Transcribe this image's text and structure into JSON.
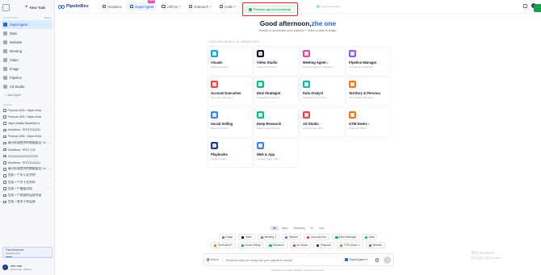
{
  "sidebar": {
    "new_task": "New Task",
    "agents_header": "AI AGENTS",
    "agents_more": "More",
    "items": [
      {
        "label": "SuperAgent",
        "icon": "superagent-icon",
        "active": true
      },
      {
        "label": "Data",
        "icon": "data-icon"
      },
      {
        "label": "Website",
        "icon": "website-icon"
      },
      {
        "label": "Meeting",
        "icon": "meeting-icon"
      },
      {
        "label": "Video",
        "icon": "video-icon"
      },
      {
        "label": "Image",
        "icon": "image-icon"
      },
      {
        "label": "Pipeline",
        "icon": "pipeline-icon"
      },
      {
        "label": "Ad Studio",
        "icon": "ad-studio-icon"
      }
    ],
    "add_agent": "Add Agent",
    "tasks_header": "TASKS",
    "tasks": [
      "Product URL: https://cha",
      "Product URL: https://cha",
      "https://static.flashintel.a",
      "Workflow: TEST2111111",
      "Product URL: https://cha",
      "请分析我提供的数据报告 :ht",
      "Workflow: TEST 101",
      "2111111111122222222",
      "Workflow: TEST2111111",
      "请分析我提供的数据报告 :ht",
      "生成一个关于北京的",
      "生成一个关于北京的",
      "生成一个播报总结",
      "生成一个或我的运营内容",
      "生成一张关于的运营"
    ],
    "trial": {
      "title": "Free trial period",
      "subtitle": "Upgrade plan",
      "progress": 0.15
    },
    "user": {
      "initials": "z",
      "name": "zhe one",
      "subtitle": "Enterprise - AiFlow +"
    }
  },
  "topbar": {
    "brand": "PipelinRev",
    "nav": [
      {
        "label": "Analytics",
        "icon": "analytics-icon",
        "chevron": false
      },
      {
        "label": "SuperAgent",
        "icon": "superagent-icon",
        "chevron": false,
        "active": true,
        "badge": "NEW"
      },
      {
        "label": "AiFlow",
        "icon": "aiflow-icon",
        "chevron": true
      },
      {
        "label": "Outreach",
        "icon": "outreach-icon",
        "chevron": true
      },
      {
        "label": "Calls",
        "icon": "calls-icon",
        "chevron": true
      },
      {
        "label": "Ma",
        "icon": "mail-icon",
        "chevron": false
      }
    ]
  },
  "toast": {
    "message": "Remove agent successfully",
    "ghost": "saved Extensions"
  },
  "main": {
    "greeting_prefix": "Good afternoon,",
    "greeting_name": "zhe one",
    "subtitle": "Ready to accelerate your pipeline? Select a task to begin.",
    "explore_label": "EXPLORE AGENTIC AI CAPABILITIES",
    "cards": [
      {
        "title": "Visuals",
        "sub": "Marketing Assets",
        "color": "#0ea5e9",
        "icon": "visuals-icon"
      },
      {
        "title": "Video Studio",
        "sub": "Stories & Outreach",
        "color": "#111827",
        "icon": "video-studio-icon"
      },
      {
        "title": "Meeting Agent",
        "sub": "Meeting Insights & Followups",
        "color": "#ec4899",
        "icon": "meeting-agent-icon",
        "chevron": true
      },
      {
        "title": "Pipeline Manager",
        "sub": "Forecasting & Deal QA",
        "color": "#8b5cf6",
        "icon": "pipeline-manager-icon"
      },
      {
        "title": "Account Executive",
        "sub": "Full-cycle sales agent",
        "color": "#ef4444",
        "icon": "account-executive-icon"
      },
      {
        "title": "Deal Strategist",
        "sub": "Negotiation & Closing",
        "color": "#10b981",
        "icon": "deal-strategist-icon"
      },
      {
        "title": "Data Analyst",
        "sub": "Cleaning & Enrichment",
        "color": "#14b8a6",
        "icon": "data-analyst-icon"
      },
      {
        "title": "Territory & Persona",
        "sub": "ICP & Market Planning",
        "color": "#f97316",
        "icon": "territory-icon"
      },
      {
        "title": "Social Selling",
        "sub": "Brand & Content",
        "color": "#3b82f6",
        "icon": "social-selling-icon"
      },
      {
        "title": "Deep Research",
        "sub": "Market intel & Reports",
        "color": "#10b981",
        "icon": "deep-research-icon"
      },
      {
        "title": "Ad Studio",
        "sub": "ads & Creative ROI",
        "color": "#ef4444",
        "icon": "ad-studio-card-icon"
      },
      {
        "title": "GTM Decks",
        "sub": "Proposals, RFPs",
        "color": "#f97316",
        "icon": "gtm-decks-icon",
        "chevron": true
      },
      {
        "title": "Playbooks",
        "sub": "Signals & Plays",
        "color": "#1e3a8a",
        "icon": "playbooks-icon"
      },
      {
        "title": "Web & App",
        "sub": "Landing Pages, Sites",
        "color": "#3b82f6",
        "icon": "web-app-icon"
      }
    ],
    "filter_tabs": [
      "All",
      "Sales",
      "Marketing",
      "Ex",
      "Ops"
    ],
    "chips_row1": [
      {
        "label": "Image",
        "color": "#8b5cf6"
      },
      {
        "label": "Video",
        "color": "#111827"
      },
      {
        "label": "Meeting",
        "color": "#ec4899",
        "chevron": true
      },
      {
        "label": "Pipeline",
        "color": "#8b5cf6"
      },
      {
        "label": "Account Exec",
        "color": "#ef4444"
      },
      {
        "label": "Deal Strategist",
        "color": "#10b981"
      },
      {
        "label": "Data",
        "color": "#14b8a6"
      }
    ],
    "chips_row2": [
      {
        "label": "Territory/ICP",
        "color": "#f97316"
      },
      {
        "label": "Social Selling",
        "color": "#3b82f6"
      },
      {
        "label": "Research",
        "color": "#10b981"
      },
      {
        "label": "Ad Studio",
        "color": "#ef4444"
      },
      {
        "label": "Playbook",
        "color": "#1e3a8a"
      },
      {
        "label": "GTM Decks",
        "color": "#f97316",
        "chevron": true
      },
      {
        "label": "Website",
        "color": "#3b82f6"
      }
    ],
    "input": {
      "attach": "Attach",
      "placeholder": "What should we bring into your pipeline today?",
      "agent": "SuperAgent"
    },
    "footnote": "PipelinRev can make mistakes. Check important info."
  },
  "watermark": {
    "line1": "激活 Windows",
    "line2": "转到\"设置\"以激活 Windows。"
  }
}
